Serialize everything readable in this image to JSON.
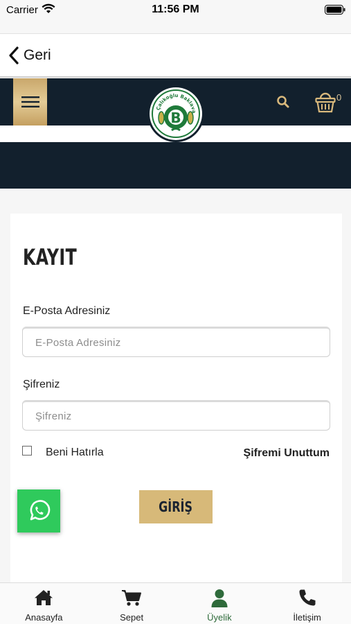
{
  "status_bar": {
    "carrier": "Carrier",
    "time": "11:56 PM"
  },
  "nav": {
    "back_label": "Geri"
  },
  "header": {
    "cart_count": "0",
    "logo_text": "Çalıkoğlu Baklava"
  },
  "form": {
    "title": "KAYIT",
    "email_label": "E-Posta Adresiniz",
    "email_placeholder": "E-Posta Adresiniz",
    "email_value": "",
    "password_label": "Şifreniz",
    "password_placeholder": "Şifreniz",
    "password_value": "",
    "remember_label": "Beni Hatırla",
    "remember_checked": false,
    "forgot_label": "Şifremi Unuttum",
    "submit_label": "GİRİŞ"
  },
  "tabs": [
    {
      "label": "Anasayfa",
      "icon": "home-icon",
      "active": false
    },
    {
      "label": "Sepet",
      "icon": "cart-icon",
      "active": false
    },
    {
      "label": "Üyelik",
      "icon": "user-icon",
      "active": true
    },
    {
      "label": "İletişim",
      "icon": "phone-icon",
      "active": false
    }
  ],
  "colors": {
    "header_bg": "#12202d",
    "gold": "#d7b979",
    "whatsapp": "#2fca5c",
    "active_tab": "#2e6a3a"
  }
}
